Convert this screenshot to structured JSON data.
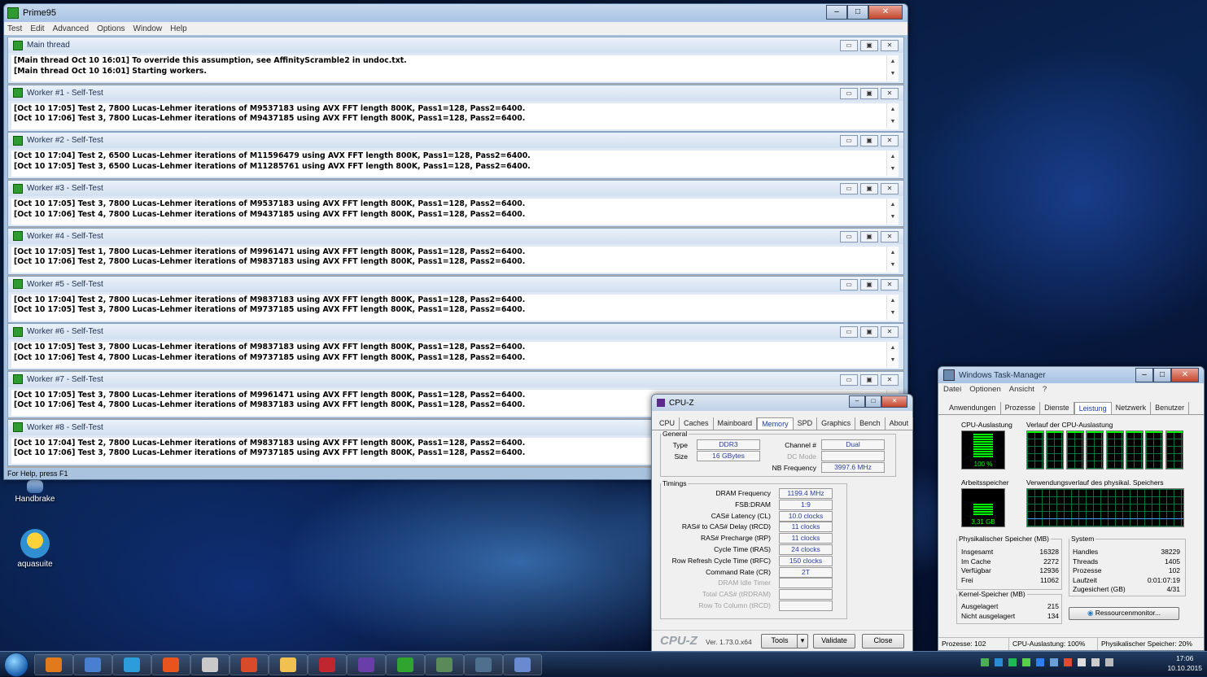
{
  "desktop": {
    "icons": [
      {
        "label": "Handbrake"
      },
      {
        "label": "aquasuite"
      }
    ]
  },
  "prime95": {
    "title": "Prime95",
    "menu": [
      "Test",
      "Edit",
      "Advanced",
      "Options",
      "Window",
      "Help"
    ],
    "status": "For Help, press F1",
    "windows": [
      {
        "title": "Main thread",
        "lines": [
          "[Main thread Oct 10 16:01] To override this assumption, see AffinityScramble2 in undoc.txt.",
          "[Main thread Oct 10 16:01] Starting workers."
        ]
      },
      {
        "title": "Worker #1 - Self-Test",
        "lines": [
          "[Oct 10 17:05] Test 2, 7800 Lucas-Lehmer iterations of M9537183 using AVX FFT length 800K, Pass1=128, Pass2=6400.",
          "[Oct 10 17:06] Test 3, 7800 Lucas-Lehmer iterations of M9437185 using AVX FFT length 800K, Pass1=128, Pass2=6400."
        ]
      },
      {
        "title": "Worker #2 - Self-Test",
        "lines": [
          "[Oct 10 17:04] Test 2, 6500 Lucas-Lehmer iterations of M11596479 using AVX FFT length 800K, Pass1=128, Pass2=6400.",
          "[Oct 10 17:05] Test 3, 6500 Lucas-Lehmer iterations of M11285761 using AVX FFT length 800K, Pass1=128, Pass2=6400."
        ]
      },
      {
        "title": "Worker #3 - Self-Test",
        "lines": [
          "[Oct 10 17:05] Test 3, 7800 Lucas-Lehmer iterations of M9537183 using AVX FFT length 800K, Pass1=128, Pass2=6400.",
          "[Oct 10 17:06] Test 4, 7800 Lucas-Lehmer iterations of M9437185 using AVX FFT length 800K, Pass1=128, Pass2=6400."
        ]
      },
      {
        "title": "Worker #4 - Self-Test",
        "lines": [
          "[Oct 10 17:05] Test 1, 7800 Lucas-Lehmer iterations of M9961471 using AVX FFT length 800K, Pass1=128, Pass2=6400.",
          "[Oct 10 17:06] Test 2, 7800 Lucas-Lehmer iterations of M9837183 using AVX FFT length 800K, Pass1=128, Pass2=6400."
        ]
      },
      {
        "title": "Worker #5 - Self-Test",
        "lines": [
          "[Oct 10 17:04] Test 2, 7800 Lucas-Lehmer iterations of M9837183 using AVX FFT length 800K, Pass1=128, Pass2=6400.",
          "[Oct 10 17:05] Test 3, 7800 Lucas-Lehmer iterations of M9737185 using AVX FFT length 800K, Pass1=128, Pass2=6400."
        ]
      },
      {
        "title": "Worker #6 - Self-Test",
        "lines": [
          "[Oct 10 17:05] Test 3, 7800 Lucas-Lehmer iterations of M9837183 using AVX FFT length 800K, Pass1=128, Pass2=6400.",
          "[Oct 10 17:06] Test 4, 7800 Lucas-Lehmer iterations of M9737185 using AVX FFT length 800K, Pass1=128, Pass2=6400."
        ]
      },
      {
        "title": "Worker #7 - Self-Test",
        "lines": [
          "[Oct 10 17:05] Test 3, 7800 Lucas-Lehmer iterations of M9961471 using AVX FFT length 800K, Pass1=128, Pass2=6400.",
          "[Oct 10 17:06] Test 4, 7800 Lucas-Lehmer iterations of M9837183 using AVX FFT length 800K, Pass1=128, Pass2=6400."
        ]
      },
      {
        "title": "Worker #8 - Self-Test",
        "lines": [
          "[Oct 10 17:04] Test 2, 7800 Lucas-Lehmer iterations of M9837183 using AVX FFT length 800K, Pass1=128, Pass2=6400.",
          "[Oct 10 17:06] Test 3, 7800 Lucas-Lehmer iterations of M9737185 using AVX FFT length 800K, Pass1=128, Pass2=6400."
        ]
      }
    ]
  },
  "cpuz": {
    "title": "CPU-Z",
    "tabs": [
      "CPU",
      "Caches",
      "Mainboard",
      "Memory",
      "SPD",
      "Graphics",
      "Bench",
      "About"
    ],
    "active_tab": "Memory",
    "general": {
      "legend": "General",
      "type_label": "Type",
      "type_value": "DDR3",
      "size_label": "Size",
      "size_value": "16 GBytes",
      "channel_label": "Channel #",
      "channel_value": "Dual",
      "dcmode_label": "DC Mode",
      "dcmode_value": "",
      "nb_label": "NB Frequency",
      "nb_value": "3997.6 MHz"
    },
    "timings": {
      "legend": "Timings",
      "rows": [
        {
          "label": "DRAM Frequency",
          "value": "1199.4 MHz",
          "dim": false
        },
        {
          "label": "FSB:DRAM",
          "value": "1:9",
          "dim": false
        },
        {
          "label": "CAS# Latency (CL)",
          "value": "10.0 clocks",
          "dim": false
        },
        {
          "label": "RAS# to CAS# Delay (tRCD)",
          "value": "11 clocks",
          "dim": false
        },
        {
          "label": "RAS# Precharge (tRP)",
          "value": "11 clocks",
          "dim": false
        },
        {
          "label": "Cycle Time (tRAS)",
          "value": "24 clocks",
          "dim": false
        },
        {
          "label": "Row Refresh Cycle Time (tRFC)",
          "value": "150 clocks",
          "dim": false
        },
        {
          "label": "Command Rate (CR)",
          "value": "2T",
          "dim": false
        },
        {
          "label": "DRAM Idle Timer",
          "value": "",
          "dim": true
        },
        {
          "label": "Total CAS# (tRDRAM)",
          "value": "",
          "dim": true
        },
        {
          "label": "Row To Column (tRCD)",
          "value": "",
          "dim": true
        }
      ]
    },
    "footer": {
      "logo": "CPU-Z",
      "version": "Ver. 1.73.0.x64",
      "tools": "Tools",
      "validate": "Validate",
      "close": "Close"
    }
  },
  "taskmanager": {
    "title": "Windows Task-Manager",
    "menu": [
      "Datei",
      "Optionen",
      "Ansicht",
      "?"
    ],
    "tabs": [
      "Anwendungen",
      "Prozesse",
      "Dienste",
      "Leistung",
      "Netzwerk",
      "Benutzer"
    ],
    "active_tab": "Leistung",
    "cpu_usage_label": "CPU-Auslastung",
    "cpu_usage_value": "100 %",
    "cpu_usage_fraction": 1.0,
    "cpu_history_label": "Verlauf der CPU-Auslastung",
    "mem_label": "Arbeitsspeicher",
    "mem_value": "3,31 GB",
    "mem_fraction": 0.2,
    "mem_history_label": "Verwendungsverlauf des physikal. Speichers",
    "phys": {
      "title": "Physikalischer Speicher (MB)",
      "rows": [
        {
          "label": "Insgesamt",
          "value": "16328"
        },
        {
          "label": "Im Cache",
          "value": "2272"
        },
        {
          "label": "Verfügbar",
          "value": "12936"
        },
        {
          "label": "Frei",
          "value": "11062"
        }
      ]
    },
    "system": {
      "title": "System",
      "rows": [
        {
          "label": "Handles",
          "value": "38229"
        },
        {
          "label": "Threads",
          "value": "1405"
        },
        {
          "label": "Prozesse",
          "value": "102"
        },
        {
          "label": "Laufzeit",
          "value": "0:01:07:19"
        },
        {
          "label": "Zugesichert (GB)",
          "value": "4/31"
        }
      ]
    },
    "kernel": {
      "title": "Kernel-Speicher (MB)",
      "rows": [
        {
          "label": "Ausgelagert",
          "value": "215"
        },
        {
          "label": "Nicht ausgelagert",
          "value": "134"
        }
      ]
    },
    "resmon_button": "Ressourcenmonitor...",
    "status": {
      "processes": "Prozesse: 102",
      "cpu": "CPU-Auslastung: 100%",
      "mem": "Physikalischer Speicher: 20%"
    }
  },
  "taskbar": {
    "time": "17:06",
    "date": "10.10.2015",
    "items": [
      "windows-media-player",
      "remote-desktop",
      "internet-explorer",
      "firefox",
      "tool",
      "app",
      "file-explorer",
      "flash-app",
      "cpu-z-app",
      "prime95-app",
      "task-manager-app",
      "aida-app",
      "network-app"
    ]
  },
  "colors": {
    "graph_green": "#00ff00",
    "graph_grid": "#008040",
    "cpuz_value_blue": "#2a3ea0"
  }
}
